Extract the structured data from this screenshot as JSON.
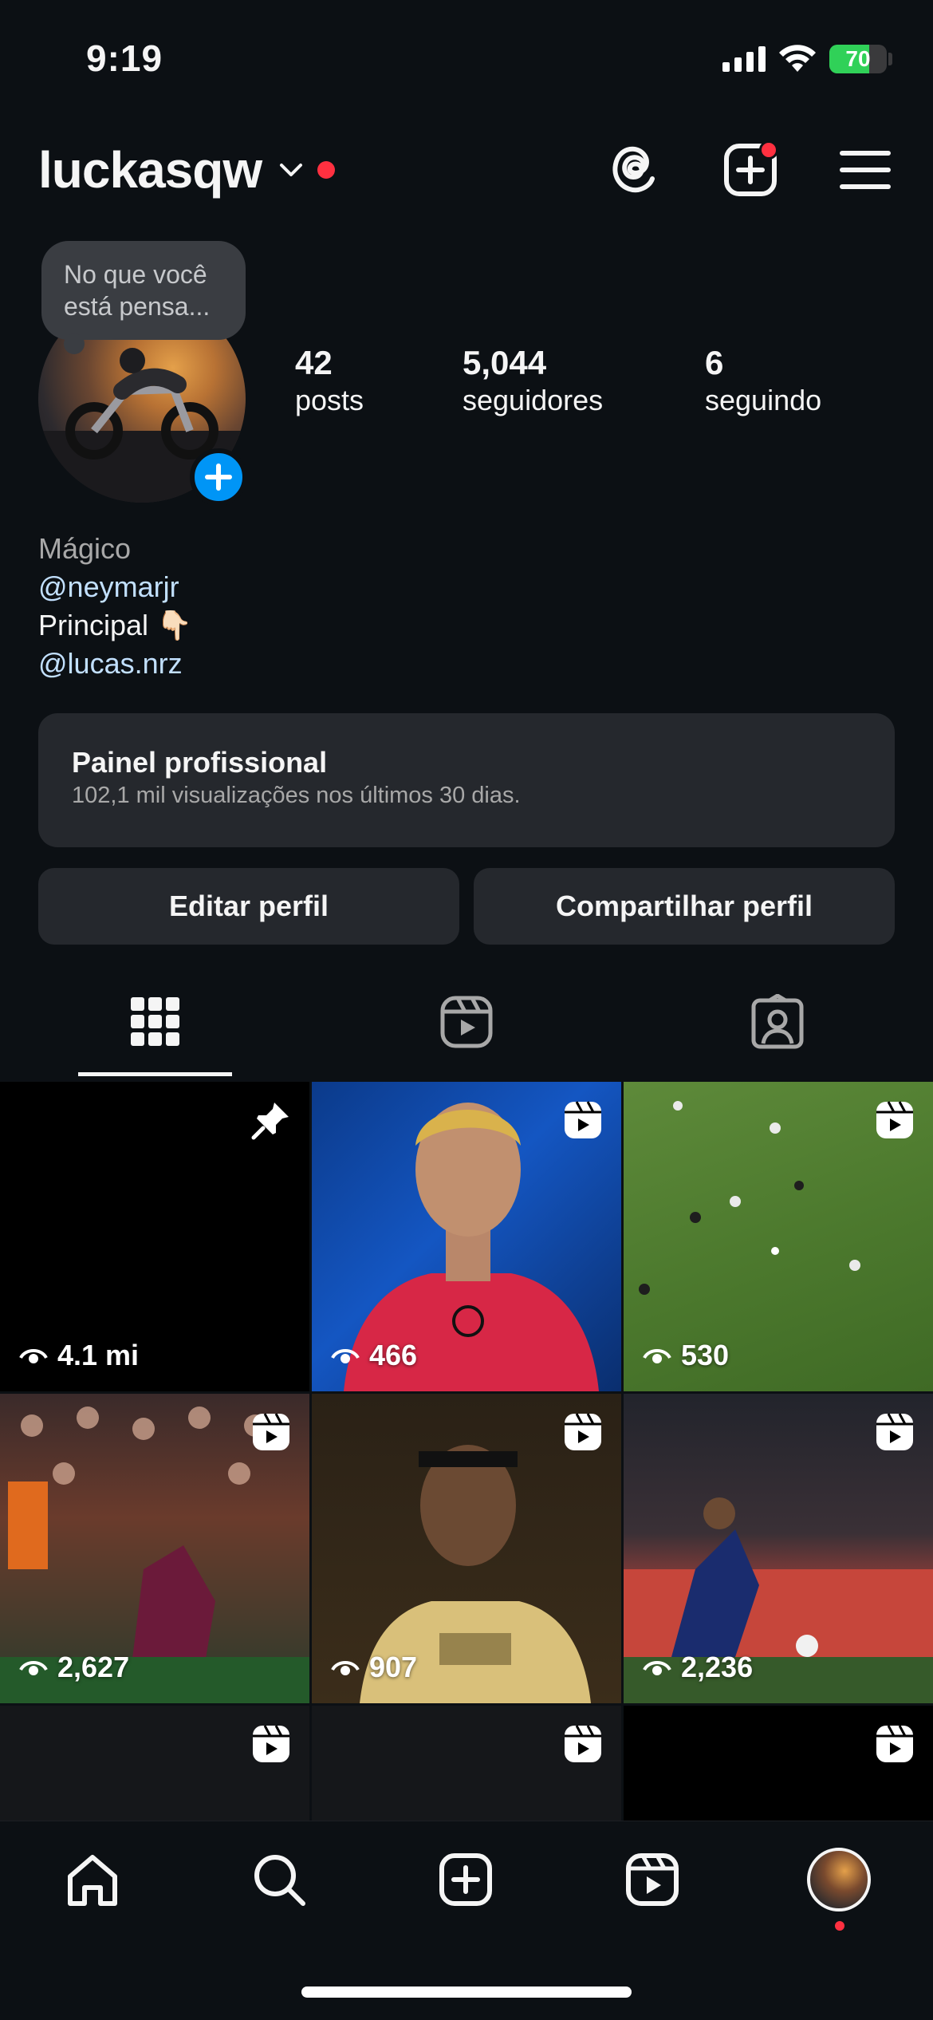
{
  "status_bar": {
    "time": "9:19",
    "battery": "70",
    "battery_level": 0.7
  },
  "header": {
    "username": "luckasqw"
  },
  "note": {
    "text_line1": "No que você",
    "text_line2": "está pensa..."
  },
  "stats": [
    {
      "value": "42",
      "label": "posts"
    },
    {
      "value": "5,044",
      "label": "seguidores"
    },
    {
      "value": "6",
      "label": "seguindo"
    }
  ],
  "bio": {
    "category": "Mágico",
    "line1": "@neymarjr",
    "line2": "Principal 👇🏻",
    "line3": "@lucas.nrz"
  },
  "pro_panel": {
    "title": "Painel profissional",
    "subtitle": "102,1 mil visualizações nos últimos 30 dias."
  },
  "buttons": {
    "edit": "Editar perfil",
    "share": "Compartilhar perfil"
  },
  "posts": [
    {
      "views": "4.1 mi",
      "type": "pinned"
    },
    {
      "views": "466",
      "type": "reel"
    },
    {
      "views": "530",
      "type": "reel"
    },
    {
      "views": "2,627",
      "type": "reel"
    },
    {
      "views": "907",
      "type": "reel"
    },
    {
      "views": "2,236",
      "type": "reel"
    },
    {
      "views": "",
      "type": "reel"
    },
    {
      "views": "",
      "type": "reel"
    },
    {
      "views": "",
      "type": "reel"
    }
  ],
  "colors": {
    "background": "#0c1014",
    "panel": "#25282d",
    "accent": "#0095f6",
    "notification": "#ff3040",
    "link": "#c2e0ff"
  },
  "icons": [
    "threads-icon",
    "new-post-icon",
    "menu-icon",
    "grid-icon",
    "reels-icon",
    "tagged-icon",
    "home-icon",
    "search-icon",
    "create-icon"
  ]
}
